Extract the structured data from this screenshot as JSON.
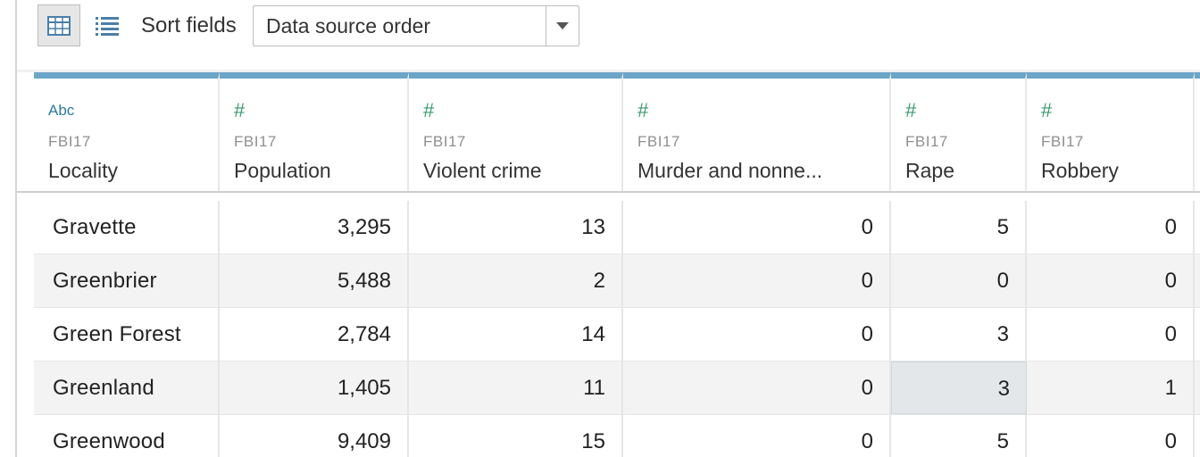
{
  "toolbar": {
    "grid_view_icon": "grid-icon",
    "list_view_icon": "list-icon",
    "sort_label": "Sort fields",
    "sort_value": "Data source order",
    "dropdown_icon": "chevron-down-icon"
  },
  "columns": [
    {
      "type": "Abc",
      "source": "FBI17",
      "name": "Locality"
    },
    {
      "type": "#",
      "source": "FBI17",
      "name": "Population"
    },
    {
      "type": "#",
      "source": "FBI17",
      "name": "Violent crime"
    },
    {
      "type": "#",
      "source": "FBI17",
      "name": "Murder and nonne..."
    },
    {
      "type": "#",
      "source": "FBI17",
      "name": "Rape"
    },
    {
      "type": "#",
      "source": "FBI17",
      "name": "Robbery"
    }
  ],
  "rows": [
    [
      "Gravette",
      "3,295",
      "13",
      "0",
      "5",
      "0"
    ],
    [
      "Greenbrier",
      "5,488",
      "2",
      "0",
      "0",
      "0"
    ],
    [
      "Green Forest",
      "2,784",
      "14",
      "0",
      "3",
      "0"
    ],
    [
      "Greenland",
      "1,405",
      "11",
      "0",
      "3",
      "1"
    ],
    [
      "Greenwood",
      "9,409",
      "15",
      "0",
      "5",
      "0"
    ]
  ],
  "selected_cell": {
    "row": 3,
    "col": 4
  },
  "colors": {
    "header_accent": "#6ba5c7",
    "string_type": "#2c7c9f",
    "number_type": "#3a9a6e",
    "alt_row": "#f3f3f3",
    "selected": "#e3e7ea"
  }
}
